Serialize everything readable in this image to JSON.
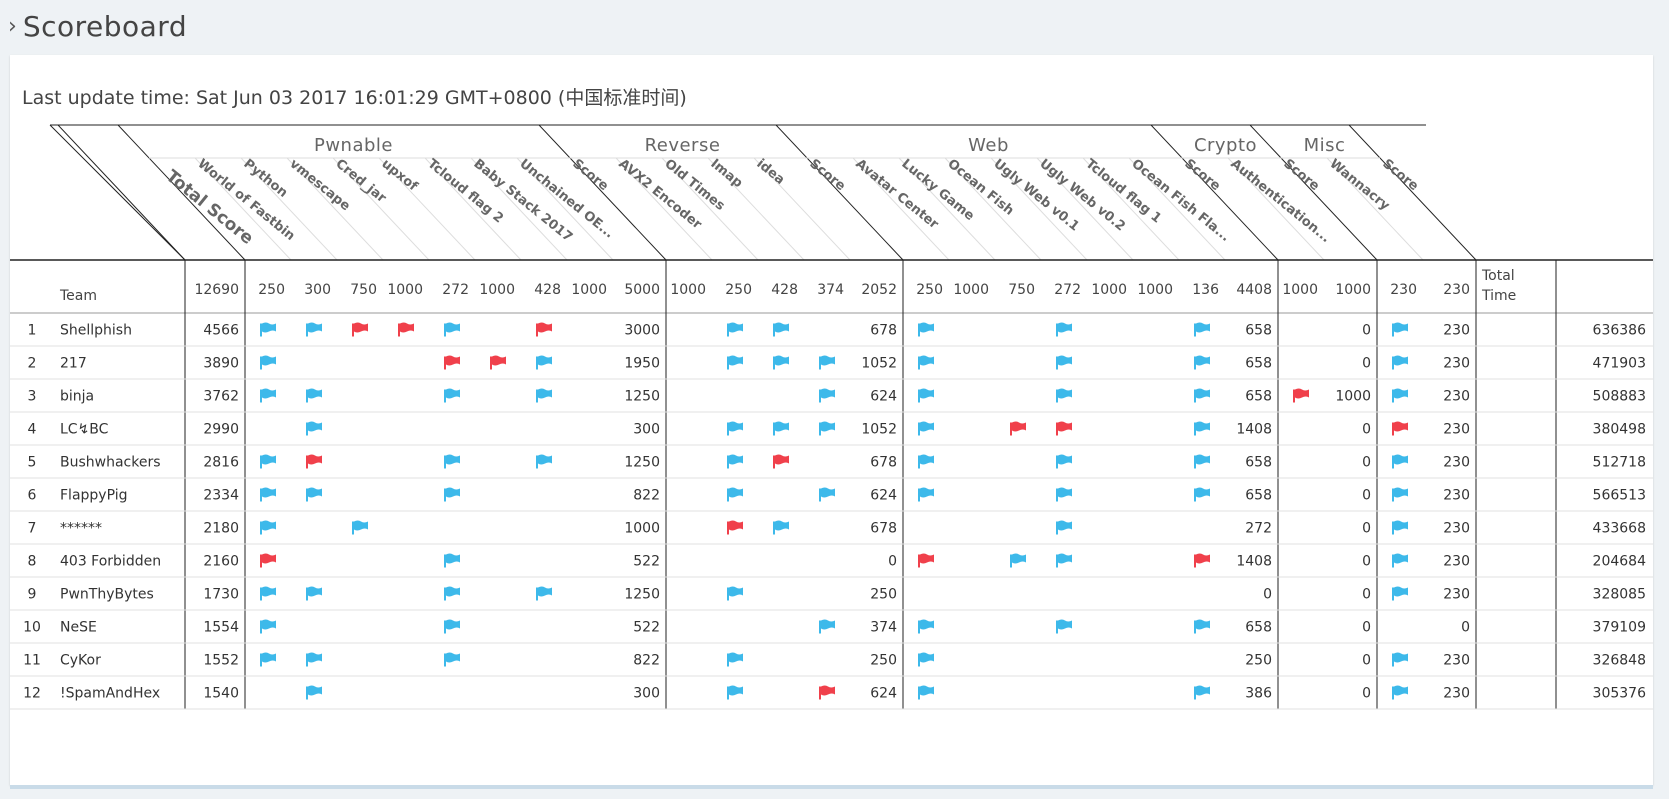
{
  "page": {
    "title": "Scoreboard"
  },
  "update_text": "Last update time: Sat Jun 03 2017 16:01:29 GMT+0800 (中国标准时间)",
  "colors": {
    "solved": "#3db9ea",
    "first_blood": "#f0404b",
    "border": "#cccccc",
    "text": "#333333"
  },
  "headers": {
    "team": "Team",
    "total_time": [
      "Total",
      "Time"
    ],
    "total_score": "Total Score"
  },
  "groups": [
    {
      "name": "Pwnable",
      "challenges": [
        "World of Fastbin",
        "Python",
        "vmescape",
        "Cred_jar",
        "upxof",
        "Tcloud flag 2",
        "Baby Stack 2017",
        "Unchained OE..."
      ],
      "score_label": "Score",
      "max_score": "5000",
      "values": [
        "250",
        "300",
        "750",
        "1000",
        "272",
        "1000",
        "428",
        "1000"
      ]
    },
    {
      "name": "Reverse",
      "challenges": [
        "AVX2 Encoder",
        "Old Times",
        "Imap",
        "idea"
      ],
      "score_label": "Score",
      "max_score": "2052",
      "values": [
        "1000",
        "250",
        "428",
        "374"
      ]
    },
    {
      "name": "Web",
      "challenges": [
        "Avatar Center",
        "Lucky Game",
        "Ocean Fish",
        "Ugly Web v0.1",
        "Ugly Web v0.2",
        "Tcloud flag 1",
        "Ocean Fish Fla..."
      ],
      "score_label": "Score",
      "max_score": "4408",
      "values": [
        "250",
        "1000",
        "750",
        "272",
        "1000",
        "1000",
        "136"
      ]
    },
    {
      "name": "Crypto",
      "challenges": [
        "Authentication..."
      ],
      "score_label": "Score",
      "max_score": "1000",
      "values": [
        "1000"
      ]
    },
    {
      "name": "Misc",
      "challenges": [
        "Wannacry"
      ],
      "score_label": "Score",
      "max_score": "230",
      "values": [
        "230"
      ]
    }
  ],
  "max_total_score": "12690",
  "teams": [
    {
      "rank": "1",
      "name": "Shellphish",
      "total": "4566",
      "time": "636386",
      "solves": [
        [
          "b",
          "b",
          "r",
          "r",
          "b",
          "",
          "r",
          ""
        ],
        [
          "",
          "b",
          "b",
          ""
        ],
        [
          "b",
          "",
          "",
          "b",
          "",
          "",
          "b"
        ],
        [
          ""
        ],
        [
          "b"
        ]
      ],
      "scores": [
        "3000",
        "678",
        "658",
        "0",
        "230"
      ]
    },
    {
      "rank": "2",
      "name": "217",
      "total": "3890",
      "time": "471903",
      "solves": [
        [
          "b",
          "",
          "",
          "",
          "r",
          "r",
          "b",
          ""
        ],
        [
          "",
          "b",
          "b",
          "b"
        ],
        [
          "b",
          "",
          "",
          "b",
          "",
          "",
          "b"
        ],
        [
          ""
        ],
        [
          "b"
        ]
      ],
      "scores": [
        "1950",
        "1052",
        "658",
        "0",
        "230"
      ]
    },
    {
      "rank": "3",
      "name": "binja",
      "total": "3762",
      "time": "508883",
      "solves": [
        [
          "b",
          "b",
          "",
          "",
          "b",
          "",
          "b",
          ""
        ],
        [
          "",
          "",
          "",
          "b"
        ],
        [
          "b",
          "",
          "",
          "b",
          "",
          "",
          "b"
        ],
        [
          "r"
        ],
        [
          "b"
        ]
      ],
      "scores": [
        "1250",
        "624",
        "658",
        "1000",
        "230"
      ]
    },
    {
      "rank": "4",
      "name": "LC↯BC",
      "total": "2990",
      "time": "380498",
      "solves": [
        [
          "",
          "b",
          "",
          "",
          "",
          "",
          "",
          ""
        ],
        [
          "",
          "b",
          "b",
          "b"
        ],
        [
          "b",
          "",
          "r",
          "r",
          "",
          "",
          "b"
        ],
        [
          ""
        ],
        [
          "r"
        ]
      ],
      "scores": [
        "300",
        "1052",
        "1408",
        "0",
        "230"
      ]
    },
    {
      "rank": "5",
      "name": "Bushwhackers",
      "total": "2816",
      "time": "512718",
      "solves": [
        [
          "b",
          "r",
          "",
          "",
          "b",
          "",
          "b",
          ""
        ],
        [
          "",
          "b",
          "r",
          ""
        ],
        [
          "b",
          "",
          "",
          "b",
          "",
          "",
          "b"
        ],
        [
          ""
        ],
        [
          "b"
        ]
      ],
      "scores": [
        "1250",
        "678",
        "658",
        "0",
        "230"
      ]
    },
    {
      "rank": "6",
      "name": "FlappyPig",
      "total": "2334",
      "time": "566513",
      "solves": [
        [
          "b",
          "b",
          "",
          "",
          "b",
          "",
          "",
          ""
        ],
        [
          "",
          "b",
          "",
          "b"
        ],
        [
          "b",
          "",
          "",
          "b",
          "",
          "",
          "b"
        ],
        [
          ""
        ],
        [
          "b"
        ]
      ],
      "scores": [
        "822",
        "624",
        "658",
        "0",
        "230"
      ]
    },
    {
      "rank": "7",
      "name": "******",
      "total": "2180",
      "time": "433668",
      "solves": [
        [
          "b",
          "",
          "b",
          "",
          "",
          "",
          "",
          ""
        ],
        [
          "",
          "r",
          "b",
          ""
        ],
        [
          "",
          "",
          "",
          "b",
          "",
          "",
          ""
        ],
        [
          ""
        ],
        [
          "b"
        ]
      ],
      "scores": [
        "1000",
        "678",
        "272",
        "0",
        "230"
      ]
    },
    {
      "rank": "8",
      "name": "403 Forbidden",
      "total": "2160",
      "time": "204684",
      "solves": [
        [
          "r",
          "",
          "",
          "",
          "b",
          "",
          "",
          ""
        ],
        [
          "",
          "",
          "",
          ""
        ],
        [
          "r",
          "",
          "b",
          "b",
          "",
          "",
          "r"
        ],
        [
          ""
        ],
        [
          "b"
        ]
      ],
      "scores": [
        "522",
        "0",
        "1408",
        "0",
        "230"
      ]
    },
    {
      "rank": "9",
      "name": "PwnThyBytes",
      "total": "1730",
      "time": "328085",
      "solves": [
        [
          "b",
          "b",
          "",
          "",
          "b",
          "",
          "b",
          ""
        ],
        [
          "",
          "b",
          "",
          ""
        ],
        [
          "",
          "",
          "",
          "",
          "",
          "",
          ""
        ],
        [
          ""
        ],
        [
          "b"
        ]
      ],
      "scores": [
        "1250",
        "250",
        "0",
        "0",
        "230"
      ]
    },
    {
      "rank": "10",
      "name": "NeSE",
      "total": "1554",
      "time": "379109",
      "solves": [
        [
          "b",
          "",
          "",
          "",
          "b",
          "",
          "",
          ""
        ],
        [
          "",
          "",
          "",
          "b"
        ],
        [
          "b",
          "",
          "",
          "b",
          "",
          "",
          "b"
        ],
        [
          ""
        ],
        [
          ""
        ]
      ],
      "scores": [
        "522",
        "374",
        "658",
        "0",
        "0"
      ]
    },
    {
      "rank": "11",
      "name": "CyKor",
      "total": "1552",
      "time": "326848",
      "solves": [
        [
          "b",
          "b",
          "",
          "",
          "b",
          "",
          "",
          ""
        ],
        [
          "",
          "b",
          "",
          ""
        ],
        [
          "b",
          "",
          "",
          "",
          "",
          "",
          ""
        ],
        [
          ""
        ],
        [
          "b"
        ]
      ],
      "scores": [
        "822",
        "250",
        "250",
        "0",
        "230"
      ]
    },
    {
      "rank": "12",
      "name": "!SpamAndHex",
      "total": "1540",
      "time": "305376",
      "solves": [
        [
          "",
          "b",
          "",
          "",
          "",
          "",
          "",
          ""
        ],
        [
          "",
          "b",
          "",
          "r"
        ],
        [
          "b",
          "",
          "",
          "",
          "",
          "",
          "b"
        ],
        [
          ""
        ],
        [
          "b"
        ]
      ],
      "scores": [
        "300",
        "624",
        "386",
        "0",
        "230"
      ]
    }
  ]
}
